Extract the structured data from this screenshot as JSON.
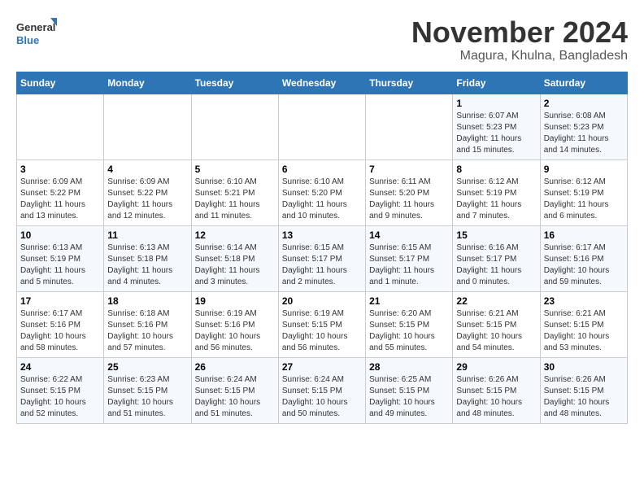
{
  "logo": {
    "line1": "General",
    "line2": "Blue"
  },
  "title": "November 2024",
  "location": "Magura, Khulna, Bangladesh",
  "headers": [
    "Sunday",
    "Monday",
    "Tuesday",
    "Wednesday",
    "Thursday",
    "Friday",
    "Saturday"
  ],
  "weeks": [
    [
      {
        "day": "",
        "info": ""
      },
      {
        "day": "",
        "info": ""
      },
      {
        "day": "",
        "info": ""
      },
      {
        "day": "",
        "info": ""
      },
      {
        "day": "",
        "info": ""
      },
      {
        "day": "1",
        "info": "Sunrise: 6:07 AM\nSunset: 5:23 PM\nDaylight: 11 hours and 15 minutes."
      },
      {
        "day": "2",
        "info": "Sunrise: 6:08 AM\nSunset: 5:23 PM\nDaylight: 11 hours and 14 minutes."
      }
    ],
    [
      {
        "day": "3",
        "info": "Sunrise: 6:09 AM\nSunset: 5:22 PM\nDaylight: 11 hours and 13 minutes."
      },
      {
        "day": "4",
        "info": "Sunrise: 6:09 AM\nSunset: 5:22 PM\nDaylight: 11 hours and 12 minutes."
      },
      {
        "day": "5",
        "info": "Sunrise: 6:10 AM\nSunset: 5:21 PM\nDaylight: 11 hours and 11 minutes."
      },
      {
        "day": "6",
        "info": "Sunrise: 6:10 AM\nSunset: 5:20 PM\nDaylight: 11 hours and 10 minutes."
      },
      {
        "day": "7",
        "info": "Sunrise: 6:11 AM\nSunset: 5:20 PM\nDaylight: 11 hours and 9 minutes."
      },
      {
        "day": "8",
        "info": "Sunrise: 6:12 AM\nSunset: 5:19 PM\nDaylight: 11 hours and 7 minutes."
      },
      {
        "day": "9",
        "info": "Sunrise: 6:12 AM\nSunset: 5:19 PM\nDaylight: 11 hours and 6 minutes."
      }
    ],
    [
      {
        "day": "10",
        "info": "Sunrise: 6:13 AM\nSunset: 5:19 PM\nDaylight: 11 hours and 5 minutes."
      },
      {
        "day": "11",
        "info": "Sunrise: 6:13 AM\nSunset: 5:18 PM\nDaylight: 11 hours and 4 minutes."
      },
      {
        "day": "12",
        "info": "Sunrise: 6:14 AM\nSunset: 5:18 PM\nDaylight: 11 hours and 3 minutes."
      },
      {
        "day": "13",
        "info": "Sunrise: 6:15 AM\nSunset: 5:17 PM\nDaylight: 11 hours and 2 minutes."
      },
      {
        "day": "14",
        "info": "Sunrise: 6:15 AM\nSunset: 5:17 PM\nDaylight: 11 hours and 1 minute."
      },
      {
        "day": "15",
        "info": "Sunrise: 6:16 AM\nSunset: 5:17 PM\nDaylight: 11 hours and 0 minutes."
      },
      {
        "day": "16",
        "info": "Sunrise: 6:17 AM\nSunset: 5:16 PM\nDaylight: 10 hours and 59 minutes."
      }
    ],
    [
      {
        "day": "17",
        "info": "Sunrise: 6:17 AM\nSunset: 5:16 PM\nDaylight: 10 hours and 58 minutes."
      },
      {
        "day": "18",
        "info": "Sunrise: 6:18 AM\nSunset: 5:16 PM\nDaylight: 10 hours and 57 minutes."
      },
      {
        "day": "19",
        "info": "Sunrise: 6:19 AM\nSunset: 5:16 PM\nDaylight: 10 hours and 56 minutes."
      },
      {
        "day": "20",
        "info": "Sunrise: 6:19 AM\nSunset: 5:15 PM\nDaylight: 10 hours and 56 minutes."
      },
      {
        "day": "21",
        "info": "Sunrise: 6:20 AM\nSunset: 5:15 PM\nDaylight: 10 hours and 55 minutes."
      },
      {
        "day": "22",
        "info": "Sunrise: 6:21 AM\nSunset: 5:15 PM\nDaylight: 10 hours and 54 minutes."
      },
      {
        "day": "23",
        "info": "Sunrise: 6:21 AM\nSunset: 5:15 PM\nDaylight: 10 hours and 53 minutes."
      }
    ],
    [
      {
        "day": "24",
        "info": "Sunrise: 6:22 AM\nSunset: 5:15 PM\nDaylight: 10 hours and 52 minutes."
      },
      {
        "day": "25",
        "info": "Sunrise: 6:23 AM\nSunset: 5:15 PM\nDaylight: 10 hours and 51 minutes."
      },
      {
        "day": "26",
        "info": "Sunrise: 6:24 AM\nSunset: 5:15 PM\nDaylight: 10 hours and 51 minutes."
      },
      {
        "day": "27",
        "info": "Sunrise: 6:24 AM\nSunset: 5:15 PM\nDaylight: 10 hours and 50 minutes."
      },
      {
        "day": "28",
        "info": "Sunrise: 6:25 AM\nSunset: 5:15 PM\nDaylight: 10 hours and 49 minutes."
      },
      {
        "day": "29",
        "info": "Sunrise: 6:26 AM\nSunset: 5:15 PM\nDaylight: 10 hours and 48 minutes."
      },
      {
        "day": "30",
        "info": "Sunrise: 6:26 AM\nSunset: 5:15 PM\nDaylight: 10 hours and 48 minutes."
      }
    ]
  ]
}
